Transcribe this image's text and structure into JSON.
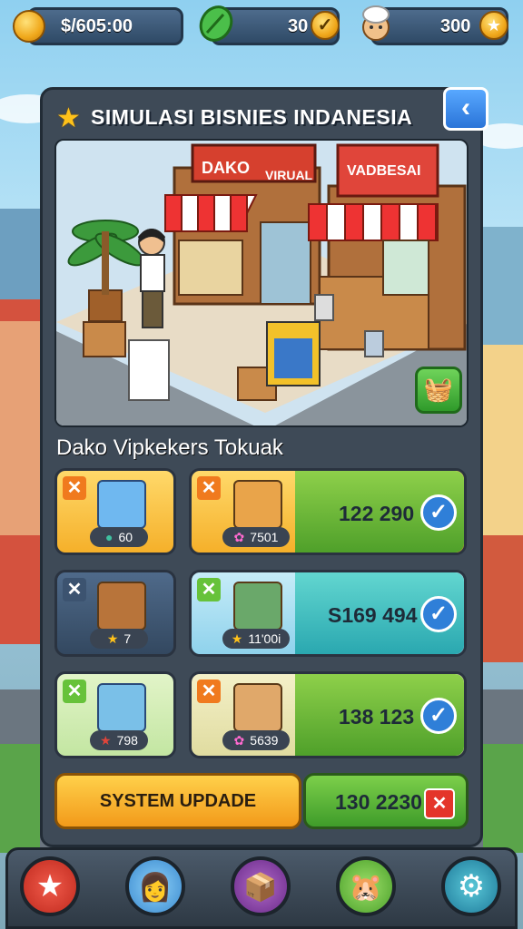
{
  "hud": {
    "money": "$/605:00",
    "gems": "30",
    "coins": "300"
  },
  "panel": {
    "title": "SIMULASI BISNIES INDANESIA",
    "scene_signs": [
      "DAKO",
      "VIRUAL",
      "VADBESAI"
    ],
    "section_title": "Dako Vipkekers Tokuak"
  },
  "items": [
    {
      "badge": "x",
      "badge_color": "orange",
      "pill": "60",
      "pill_icon": "gem-icon"
    },
    {
      "badge": "x",
      "badge_color": "orange",
      "pill": "7501",
      "pill_icon": "flower-icon",
      "amount": "122 290"
    },
    {
      "badge": "x",
      "badge_color": "dark",
      "pill": "7",
      "pill_icon": "star-icon"
    },
    {
      "badge": "x",
      "badge_color": "green",
      "pill": "11'00i",
      "pill_icon": "star-icon",
      "amount": "S169 494"
    },
    {
      "badge": "x",
      "badge_color": "green",
      "pill": "798",
      "pill_icon": "star-icon"
    },
    {
      "badge": "x",
      "badge_color": "orange",
      "pill": "5639",
      "pill_icon": "flower-icon",
      "amount": "138 123"
    }
  ],
  "update": {
    "label": "SYSTEM UPDADE",
    "amount": "130 2230"
  },
  "colors": {
    "accent_orange": "#f29a1a",
    "accent_green": "#6fd35a",
    "accent_blue": "#2f7fd8",
    "panel": "#3e4a57"
  }
}
